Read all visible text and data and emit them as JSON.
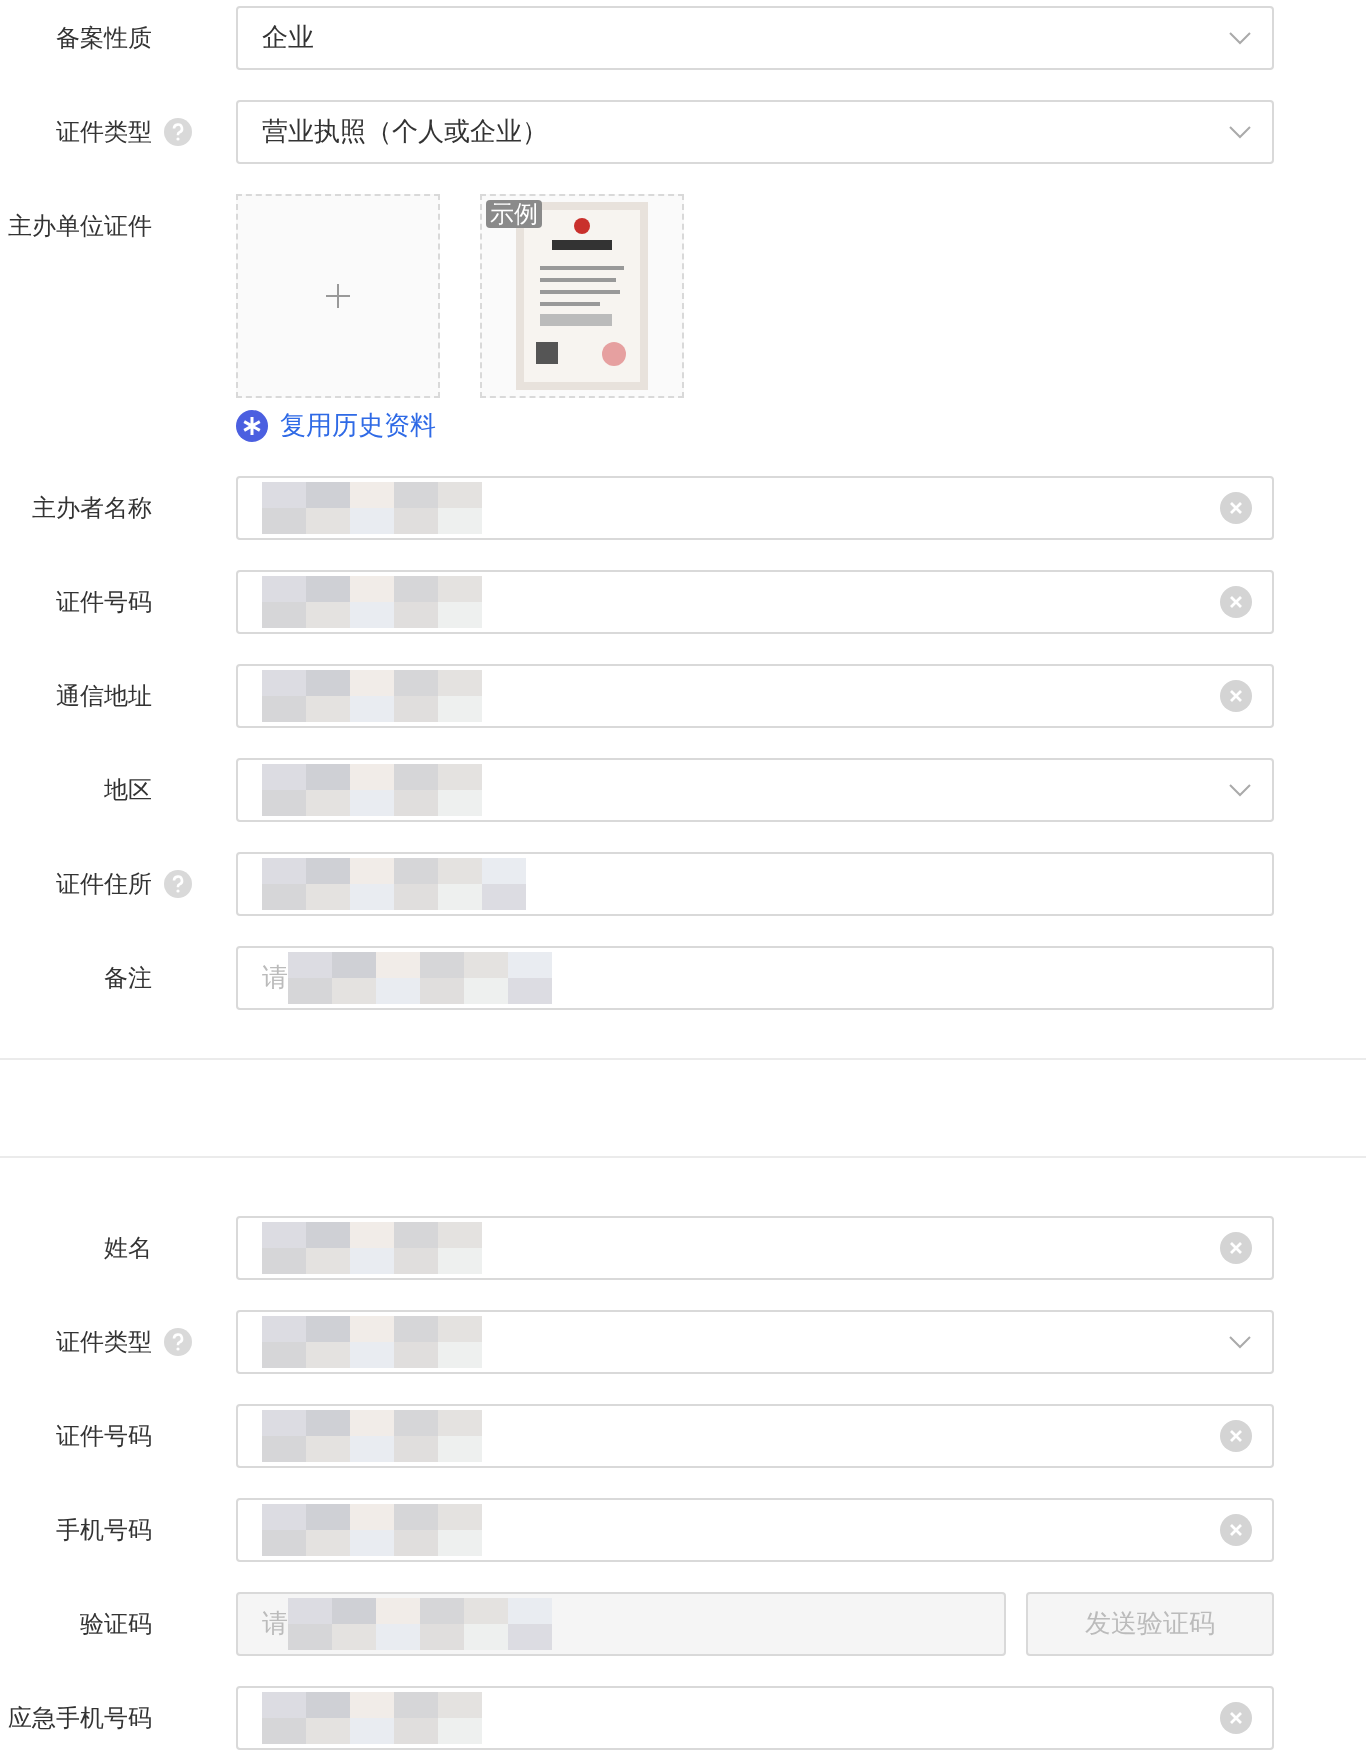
{
  "section_1": {
    "rows": [
      {
        "kind": "select",
        "label": "备案性质",
        "help": false,
        "value": "企业",
        "redacted": false
      },
      {
        "kind": "select",
        "label": "证件类型",
        "help": true,
        "value": "营业执照（个人或企业）",
        "redacted": false
      },
      {
        "kind": "upload",
        "label": "主办单位证件",
        "help": false,
        "sample_badge": "示例",
        "link": "复用历史资料"
      },
      {
        "kind": "input",
        "label": "主办者名称",
        "help": false,
        "redacted": true
      },
      {
        "kind": "input",
        "label": "证件号码",
        "help": false,
        "redacted": true
      },
      {
        "kind": "input",
        "label": "通信地址",
        "help": false,
        "redacted": true
      },
      {
        "kind": "select",
        "label": "地区",
        "help": false,
        "redacted": true
      },
      {
        "kind": "text",
        "label": "证件住所",
        "help": true,
        "redacted": true
      },
      {
        "kind": "text",
        "label": "备注",
        "help": false,
        "placeholder": "请",
        "redacted": true
      }
    ]
  },
  "section_2": {
    "rows": [
      {
        "kind": "input",
        "label": "姓名",
        "help": false,
        "redacted": true
      },
      {
        "kind": "select",
        "label": "证件类型",
        "help": true,
        "redacted": true
      },
      {
        "kind": "input",
        "label": "证件号码",
        "help": false,
        "redacted": true
      },
      {
        "kind": "input",
        "label": "手机号码",
        "help": false,
        "redacted": true
      },
      {
        "kind": "code",
        "label": "验证码",
        "help": false,
        "placeholder": "请",
        "button": "发送验证码",
        "disabled": true,
        "redacted": true
      },
      {
        "kind": "input",
        "label": "应急手机号码",
        "help": false,
        "redacted": true
      }
    ]
  }
}
